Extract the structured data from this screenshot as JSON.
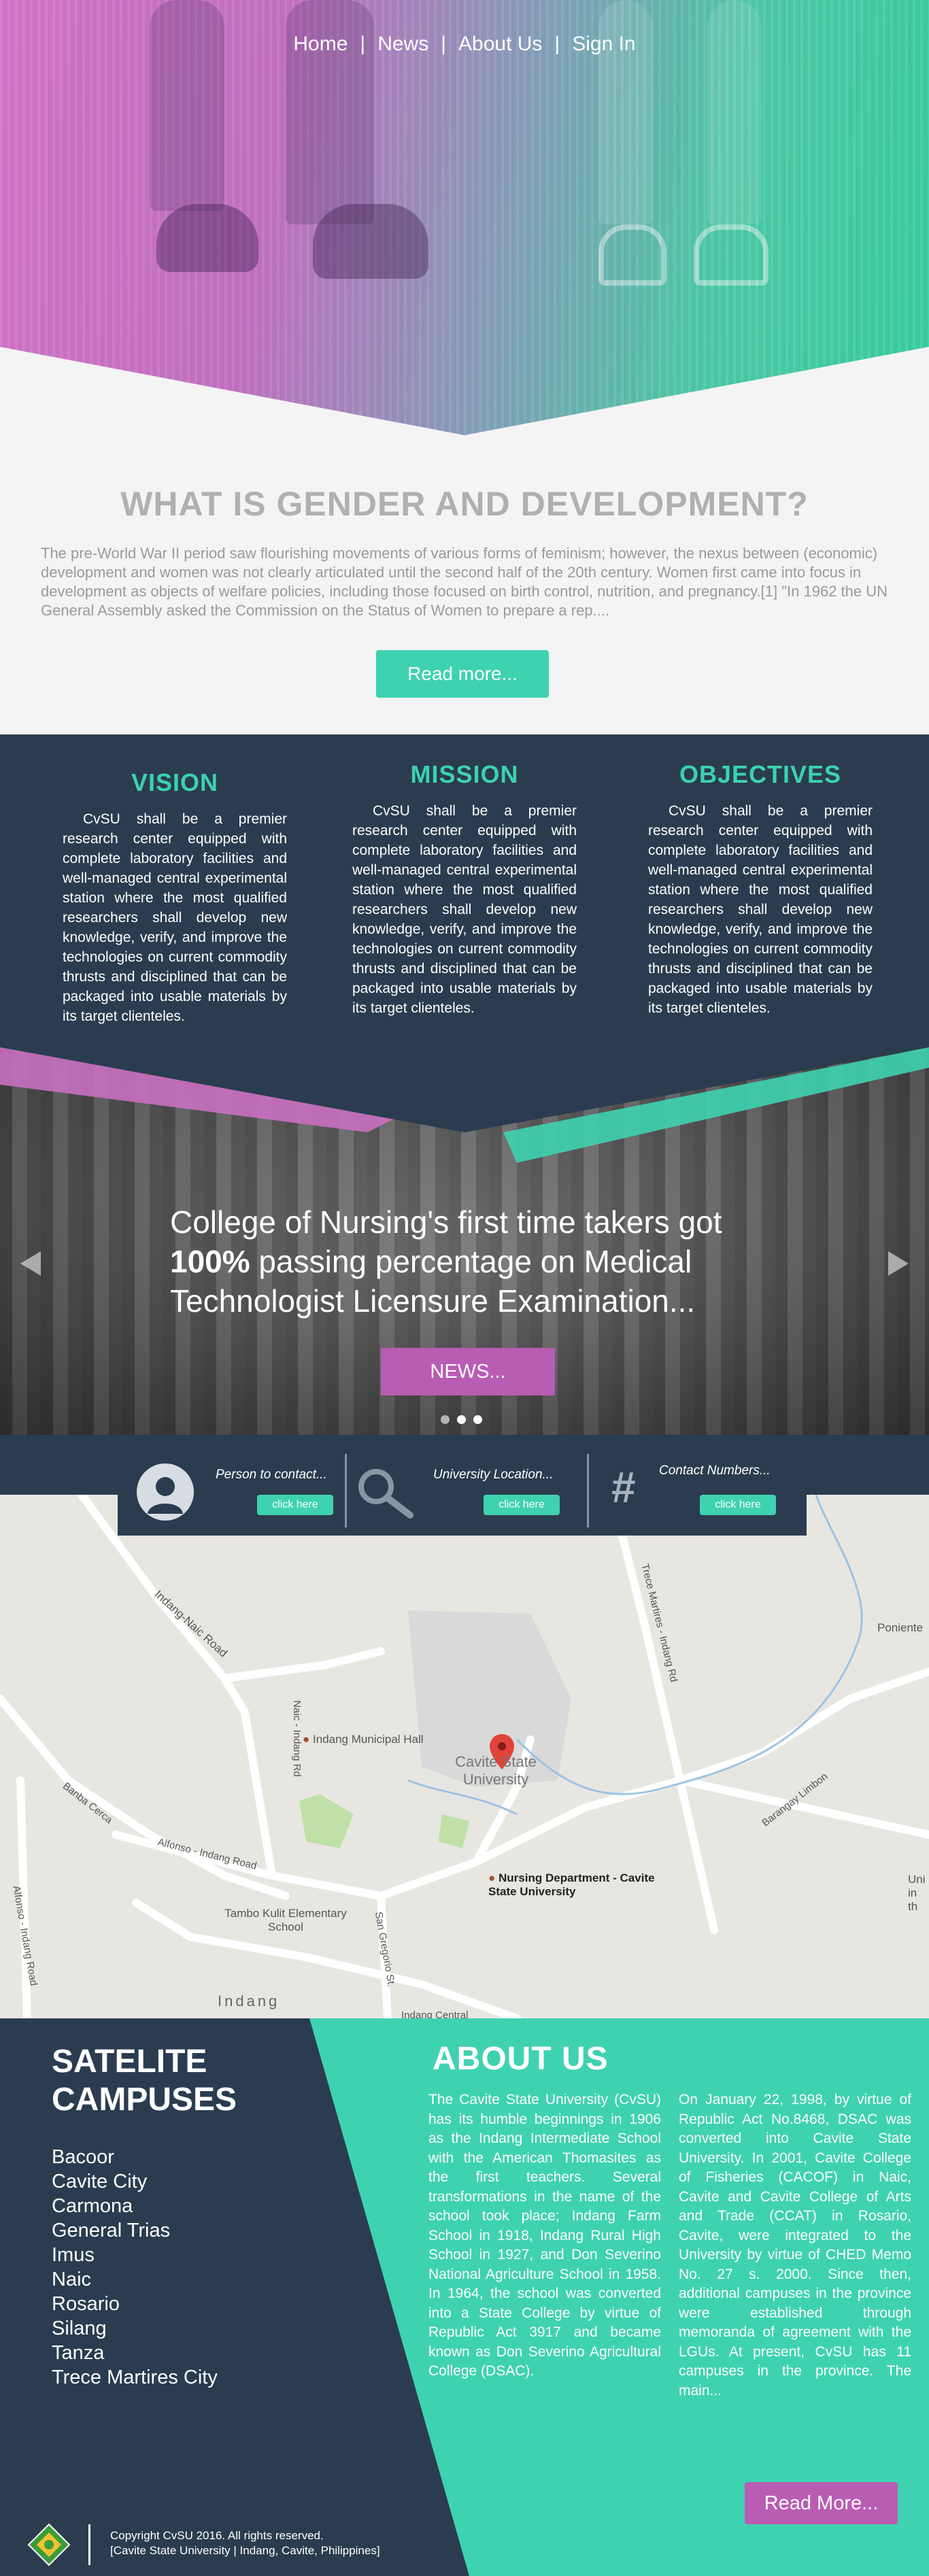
{
  "nav": {
    "items": [
      "Home",
      "News",
      "About Us",
      "Sign In"
    ],
    "separator": "|"
  },
  "gender": {
    "title": "WHAT IS GENDER AND DEVELOPMENT?",
    "text": "The pre-World War II period saw flourishing movements of various forms of feminism; however, the nexus between (economic) development and women was not clearly articulated until the second half of the 20th century. Women first came into focus in development as objects of welfare policies, including those focused on birth control, nutrition, and pregnancy.[1] \"In 1962 the UN General Assembly asked the Commission on the Status of Women to prepare a rep....",
    "read_more": "Read more..."
  },
  "vmo": [
    {
      "title": "VISION",
      "text": "CvSU shall be a premier research center equipped with complete laboratory facilities and well-managed central experimental station where the most qualified researchers shall develop new knowledge, verify, and improve the technologies on current commodity thrusts and disciplined that can be packaged into usable materials by its target clienteles."
    },
    {
      "title": "MISSION",
      "text": "CvSU shall be a premier research center equipped with complete laboratory facilities and well-managed central experimental station where the most qualified researchers shall develop new knowledge, verify, and improve the technologies on current commodity thrusts and disciplined that can be packaged into usable materials by its target clienteles."
    },
    {
      "title": "OBJECTIVES",
      "text": "CvSU shall be a premier research center equipped with complete laboratory facilities and well-managed central experimental station where the most qualified researchers shall develop new knowledge, verify, and improve the technologies on current commodity thrusts and disciplined that can be packaged into usable materials by its target clienteles."
    }
  ],
  "news": {
    "title_line1": "College of Nursing's first time takers got",
    "title_bold": "100%",
    "title_rest": " passing percentage on Medical",
    "title_line3": "Technologist Licensure Examination...",
    "button": "NEWS...",
    "active_dot": 1
  },
  "contact": {
    "items": [
      {
        "label": "Person to contact...",
        "button": "click here",
        "icon": "person-icon"
      },
      {
        "label": "University Location...",
        "button": "click here",
        "icon": "search-icon"
      },
      {
        "label": "Contact Numbers...",
        "button": "click here",
        "icon": "hash-icon"
      }
    ]
  },
  "map": {
    "labels": {
      "indang_naic_road": "Indang-Naic Road",
      "naic_indang_rd": "Naic - Indang Rd",
      "municipal_hall": "Indang Municipal Hall",
      "cavite_state": "Cavite State University",
      "trece_martires": "Trece Martires - Indang Rd",
      "barangay_limbon": "Barangay Limbon",
      "poniente": "Poniente",
      "banba_cerca": "Banba Cerca",
      "alfonso_indang_road": "Alfonso - Indang Road",
      "alfonso_indang_road2": "Alfonso - Indang Road",
      "tambo_kulit": "Tambo Kulit Elementary School",
      "san_gregorio": "San Gregorio St.",
      "nursing_dept": "Nursing Department - Cavite State University",
      "indang": "Indang",
      "indang_central": "Indang Central",
      "edge_right": "Uni in th"
    }
  },
  "footer": {
    "campus_title_line1": "SATELITE",
    "campus_title_line2": "CAMPUSES",
    "campuses": [
      "Bacoor",
      "Cavite City",
      "Carmona",
      "General Trias",
      "Imus",
      "Naic",
      "Rosario",
      "Silang",
      "Tanza",
      "Trece Martires City"
    ],
    "about_title": "ABOUT US",
    "about_col1": "The Cavite State University (CvSU) has its humble beginnings in 1906 as the Indang Intermediate School with the American Thomasites as the first teachers. Several transformations in the name of the school took place; Indang Farm School in 1918, Indang Rural High School in 1927, and Don Severino National Agriculture School in 1958. In 1964, the school was converted into a State College by virtue of Republic Act 3917 and became known as Don Severino Agricultural College (DSAC).",
    "about_col2": "On January 22, 1998, by virtue of Republic Act No.8468, DSAC was converted into Cavite State University. In 2001, Cavite College of Fisheries (CACOF) in Naic, Cavite and Cavite College of Arts and Trade (CCAT) in Rosario, Cavite, were integrated to the University by virtue of CHED Memo No. 27 s. 2000. Since then, additional campuses in the province were established through memoranda of agreement with the LGUs. At present, CvSU has 11 campuses in the province. The main...",
    "read_more": "Read More...",
    "copyright_line1": "Copyright CvSU 2016. All rights reserved.",
    "copyright_line2": "[Cavite State University | Indang, Cavite, Philippines]"
  },
  "colors": {
    "teal": "#3fd2b0",
    "navy": "#2b3c50",
    "magenta": "#b95cb4",
    "title_gray": "#b0b0b0"
  }
}
